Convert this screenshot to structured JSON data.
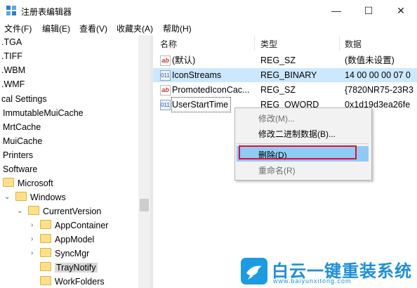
{
  "window": {
    "title": "注册表编辑器",
    "minimize_glyph": "—",
    "maximize_glyph": "☐",
    "close_glyph": "✕",
    "icon": "regedit-icon"
  },
  "menu": [
    "文件(F)",
    "编辑(E)",
    "查看(V)",
    "收藏夹(A)",
    "帮助(H)"
  ],
  "tree": {
    "items": [
      {
        "label": ".TGA"
      },
      {
        "label": ".TIFF"
      },
      {
        "label": ".WBM"
      },
      {
        "label": ".WMF"
      },
      {
        "label": "cal Settings"
      },
      {
        "label": "ImmutableMuiCache"
      },
      {
        "label": "MrtCache"
      },
      {
        "label": "MuiCache"
      },
      {
        "label": "Printers"
      },
      {
        "label": "Software"
      },
      {
        "label": "Microsoft"
      },
      {
        "label": "Windows"
      },
      {
        "label": "CurrentVersion"
      },
      {
        "label": "AppContainer"
      },
      {
        "label": "AppModel"
      },
      {
        "label": "SyncMgr"
      },
      {
        "label": "TrayNotify"
      },
      {
        "label": "WorkFolders"
      }
    ]
  },
  "list": {
    "columns": [
      "名称",
      "类型",
      "数据"
    ],
    "rows": [
      {
        "name": "(默认)",
        "type": "REG_SZ",
        "data": "(数值未设置)",
        "icon": "string-value-icon"
      },
      {
        "name": "IconStreams",
        "type": "REG_BINARY",
        "data": "14 00 00 00 07 0",
        "icon": "binary-value-icon"
      },
      {
        "name": "PromotedIconCac...",
        "type": "REG_SZ",
        "data": "{7820NR75-23R3",
        "icon": "string-value-icon"
      },
      {
        "name": "UserStartTime",
        "type": "REG_QWORD",
        "data": "0x1d19d3ea26fe",
        "icon": "binary-value-icon"
      }
    ]
  },
  "context_menu": {
    "modify": "修改(M)...",
    "modify_binary": "修改二进制数据(B)...",
    "delete": "删除(D)",
    "rename": "重命名(R)"
  },
  "watermark": {
    "brand": "白云一键重装系统",
    "url": "www.baiyunxitong.com",
    "icon": "bird-logo-icon"
  },
  "colors": {
    "selection": "#cce8ff",
    "menu_highlight": "#91c9f7",
    "highlight_box": "#e0102a",
    "brand": "#1e8fd8"
  }
}
